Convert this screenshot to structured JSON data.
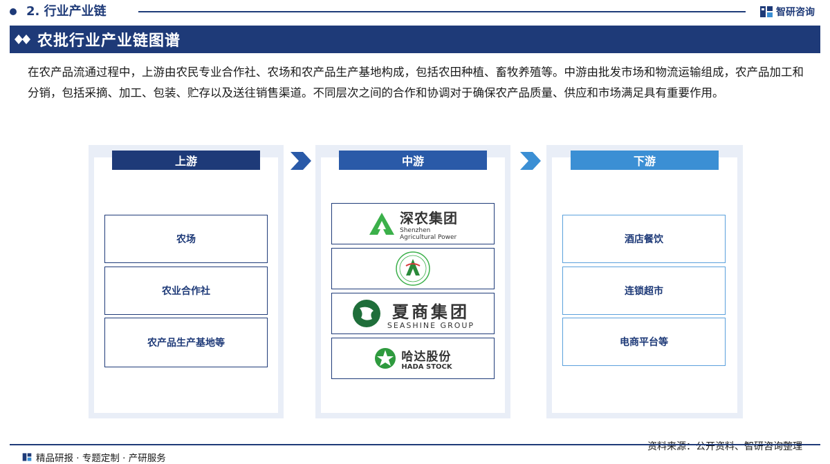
{
  "header": {
    "section": "2. 行业产业链",
    "brand": "智研咨询"
  },
  "title": "农批行业产业链图谱",
  "intro": "在农产品流通过程中，上游由农民专业合作社、农场和农产品生产基地构成，包括农田种植、畜牧养殖等。中游由批发市场和物流运输组成，农产品加工和分销，包括采摘、加工、包装、贮存以及送往销售渠道。不同层次之间的合作和协调对于确保农产品质量、供应和市场满足具有重要作用。",
  "upstream": {
    "label": "上游",
    "items": [
      "农场",
      "农业合作社",
      "农产品生产基地等"
    ]
  },
  "midstream": {
    "label": "中游",
    "logos": [
      {
        "name": "深农集团",
        "sub1": "Shenzhen",
        "sub2": "Agricultural Power",
        "icon": "shennong-logo-icon"
      },
      {
        "name": "",
        "icon": "circle-emblem-logo-icon"
      },
      {
        "name": "夏商集团",
        "sub1": "SEASHINE GROUP",
        "icon": "seashine-logo-icon"
      },
      {
        "name": "哈达股份",
        "sub1": "HADA STOCK",
        "icon": "hada-logo-icon"
      }
    ]
  },
  "downstream": {
    "label": "下游",
    "items": [
      "酒店餐饮",
      "连锁超市",
      "电商平台等"
    ]
  },
  "footer": {
    "source": "资料来源：公开资料、智研咨询整理",
    "tagline": "精品研报 · 专题定制 · 产研服务"
  },
  "colors": {
    "primary": "#1e3a78",
    "mid": "#2a5aa8",
    "light": "#3b8fd4",
    "panel": "#e9eef7"
  }
}
